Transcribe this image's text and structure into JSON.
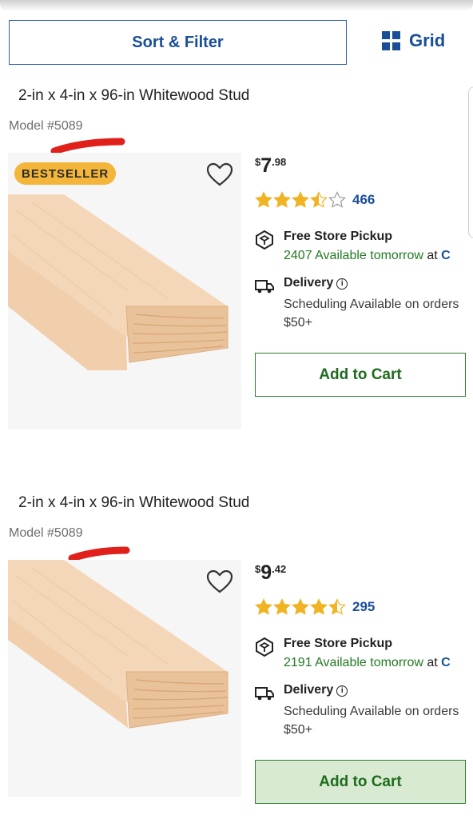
{
  "toolbar": {
    "sort_label": "Sort & Filter",
    "view_label": "Grid"
  },
  "products": [
    {
      "title": "2-in x 4-in x 96-in Whitewood Stud",
      "model": "Model #5089",
      "badge": "BESTSELLER",
      "price": {
        "currency": "$",
        "dollars": "7",
        "cents": ".98"
      },
      "rating": 3.5,
      "reviews": "466",
      "pickup": {
        "title": "Free Store Pickup",
        "availability": "2407 Available tomorrow",
        "at": "at",
        "store": "C"
      },
      "delivery": {
        "title": "Delivery",
        "note": "Scheduling Available on orders $50+"
      },
      "cart_label": "Add to Cart"
    },
    {
      "title": "2-in x 4-in x 96-in Whitewood Stud",
      "model": "Model #5089",
      "price": {
        "currency": "$",
        "dollars": "9",
        "cents": ".42"
      },
      "rating": 4.5,
      "reviews": "295",
      "pickup": {
        "title": "Free Store Pickup",
        "availability": "2191 Available tomorrow",
        "at": "at",
        "store": "C"
      },
      "delivery": {
        "title": "Delivery",
        "note": "Scheduling Available on orders $50+"
      },
      "cart_label": "Add to Cart"
    }
  ],
  "colors": {
    "brand_blue": "#1a4e99",
    "badge_yellow": "#f3b63a",
    "star_gold": "#f0b323",
    "available_green": "#237a23",
    "annotation_red": "#e0201b"
  },
  "icons": {
    "grid": "grid-icon",
    "wishlist": "heart-icon",
    "pickup": "store-pickup-icon",
    "delivery": "delivery-truck-icon",
    "info": "info-icon"
  }
}
